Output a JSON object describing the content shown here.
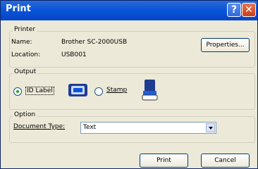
{
  "window": {
    "title": "Print",
    "help_glyph": "?",
    "close_glyph": "✕"
  },
  "printer": {
    "legend": "Printer",
    "name_label": "Name:",
    "name_value": "Brother SC-2000USB",
    "location_label": "Location:",
    "location_value": "USB001",
    "properties_label": "Properties..."
  },
  "output": {
    "legend": "Output",
    "options": [
      {
        "label": "ID Label",
        "selected": true,
        "icon": "id-label-icon"
      },
      {
        "label": "Stamp",
        "selected": false,
        "icon": "stamp-icon"
      }
    ]
  },
  "option": {
    "legend": "Option",
    "document_type_label": "Document Type:",
    "document_type_value": "Text"
  },
  "buttons": {
    "print_label": "Print",
    "cancel_label": "Cancel"
  }
}
